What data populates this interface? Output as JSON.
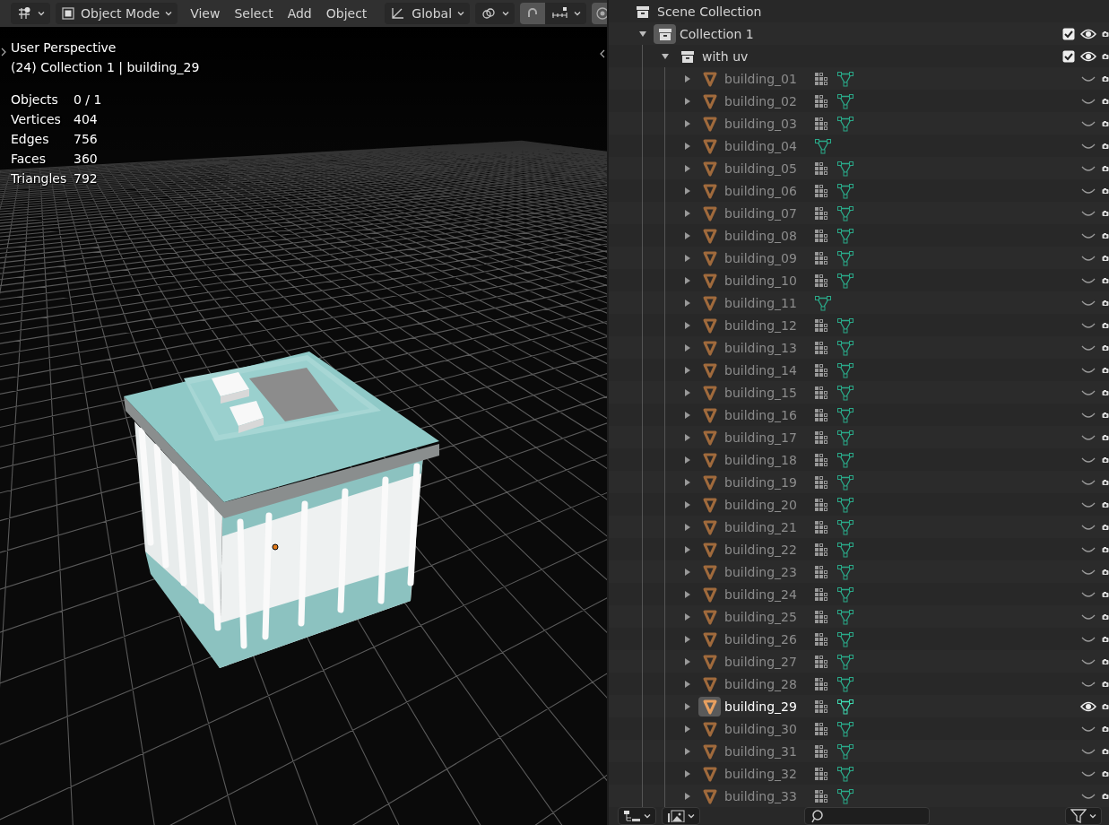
{
  "toolbar": {
    "mode": "Object Mode",
    "menus": [
      "View",
      "Select",
      "Add",
      "Object"
    ],
    "orientation": "Global"
  },
  "viewport": {
    "view_name": "User Perspective",
    "context": "(24) Collection 1 | building_29",
    "stats": [
      {
        "label": "Objects",
        "value": "0 / 1"
      },
      {
        "label": "Vertices",
        "value": "404"
      },
      {
        "label": "Edges",
        "value": "756"
      },
      {
        "label": "Faces",
        "value": "360"
      },
      {
        "label": "Triangles",
        "value": "792"
      }
    ]
  },
  "outliner": {
    "root": "Scene Collection",
    "collections": [
      {
        "name": "Collection 1",
        "expanded": true,
        "checked": true,
        "visible": true,
        "children": [
          {
            "name": "with uv",
            "expanded": true,
            "checked": true,
            "visible": true,
            "children": [
              {
                "name": "building_01",
                "expanded": false,
                "has_modifiers": true,
                "visible": false,
                "active": false
              },
              {
                "name": "building_02",
                "expanded": false,
                "has_modifiers": true,
                "visible": false,
                "active": false
              },
              {
                "name": "building_03",
                "expanded": false,
                "has_modifiers": true,
                "visible": false,
                "active": false
              },
              {
                "name": "building_04",
                "expanded": false,
                "has_modifiers": false,
                "visible": false,
                "active": false
              },
              {
                "name": "building_05",
                "expanded": false,
                "has_modifiers": true,
                "visible": false,
                "active": false
              },
              {
                "name": "building_06",
                "expanded": false,
                "has_modifiers": true,
                "visible": false,
                "active": false
              },
              {
                "name": "building_07",
                "expanded": false,
                "has_modifiers": true,
                "visible": false,
                "active": false
              },
              {
                "name": "building_08",
                "expanded": false,
                "has_modifiers": true,
                "visible": false,
                "active": false
              },
              {
                "name": "building_09",
                "expanded": false,
                "has_modifiers": true,
                "visible": false,
                "active": false
              },
              {
                "name": "building_10",
                "expanded": false,
                "has_modifiers": true,
                "visible": false,
                "active": false
              },
              {
                "name": "building_11",
                "expanded": false,
                "has_modifiers": false,
                "visible": false,
                "active": false
              },
              {
                "name": "building_12",
                "expanded": false,
                "has_modifiers": true,
                "visible": false,
                "active": false
              },
              {
                "name": "building_13",
                "expanded": false,
                "has_modifiers": true,
                "visible": false,
                "active": false
              },
              {
                "name": "building_14",
                "expanded": false,
                "has_modifiers": true,
                "visible": false,
                "active": false
              },
              {
                "name": "building_15",
                "expanded": false,
                "has_modifiers": true,
                "visible": false,
                "active": false
              },
              {
                "name": "building_16",
                "expanded": false,
                "has_modifiers": true,
                "visible": false,
                "active": false
              },
              {
                "name": "building_17",
                "expanded": false,
                "has_modifiers": true,
                "visible": false,
                "active": false
              },
              {
                "name": "building_18",
                "expanded": false,
                "has_modifiers": true,
                "visible": false,
                "active": false
              },
              {
                "name": "building_19",
                "expanded": false,
                "has_modifiers": true,
                "visible": false,
                "active": false
              },
              {
                "name": "building_20",
                "expanded": false,
                "has_modifiers": true,
                "visible": false,
                "active": false
              },
              {
                "name": "building_21",
                "expanded": false,
                "has_modifiers": true,
                "visible": false,
                "active": false
              },
              {
                "name": "building_22",
                "expanded": false,
                "has_modifiers": true,
                "visible": false,
                "active": false
              },
              {
                "name": "building_23",
                "expanded": false,
                "has_modifiers": true,
                "visible": false,
                "active": false
              },
              {
                "name": "building_24",
                "expanded": false,
                "has_modifiers": true,
                "visible": false,
                "active": false
              },
              {
                "name": "building_25",
                "expanded": false,
                "has_modifiers": true,
                "visible": false,
                "active": false
              },
              {
                "name": "building_26",
                "expanded": false,
                "has_modifiers": true,
                "visible": false,
                "active": false
              },
              {
                "name": "building_27",
                "expanded": false,
                "has_modifiers": true,
                "visible": false,
                "active": false
              },
              {
                "name": "building_28",
                "expanded": false,
                "has_modifiers": true,
                "visible": false,
                "active": false
              },
              {
                "name": "building_29",
                "expanded": false,
                "has_modifiers": true,
                "visible": true,
                "active": true
              },
              {
                "name": "building_30",
                "expanded": false,
                "has_modifiers": true,
                "visible": false,
                "active": false
              },
              {
                "name": "building_31",
                "expanded": false,
                "has_modifiers": true,
                "visible": false,
                "active": false
              },
              {
                "name": "building_32",
                "expanded": false,
                "has_modifiers": true,
                "visible": false,
                "active": false
              },
              {
                "name": "building_33",
                "expanded": false,
                "has_modifiers": true,
                "visible": false,
                "active": false
              }
            ]
          }
        ]
      }
    ]
  }
}
